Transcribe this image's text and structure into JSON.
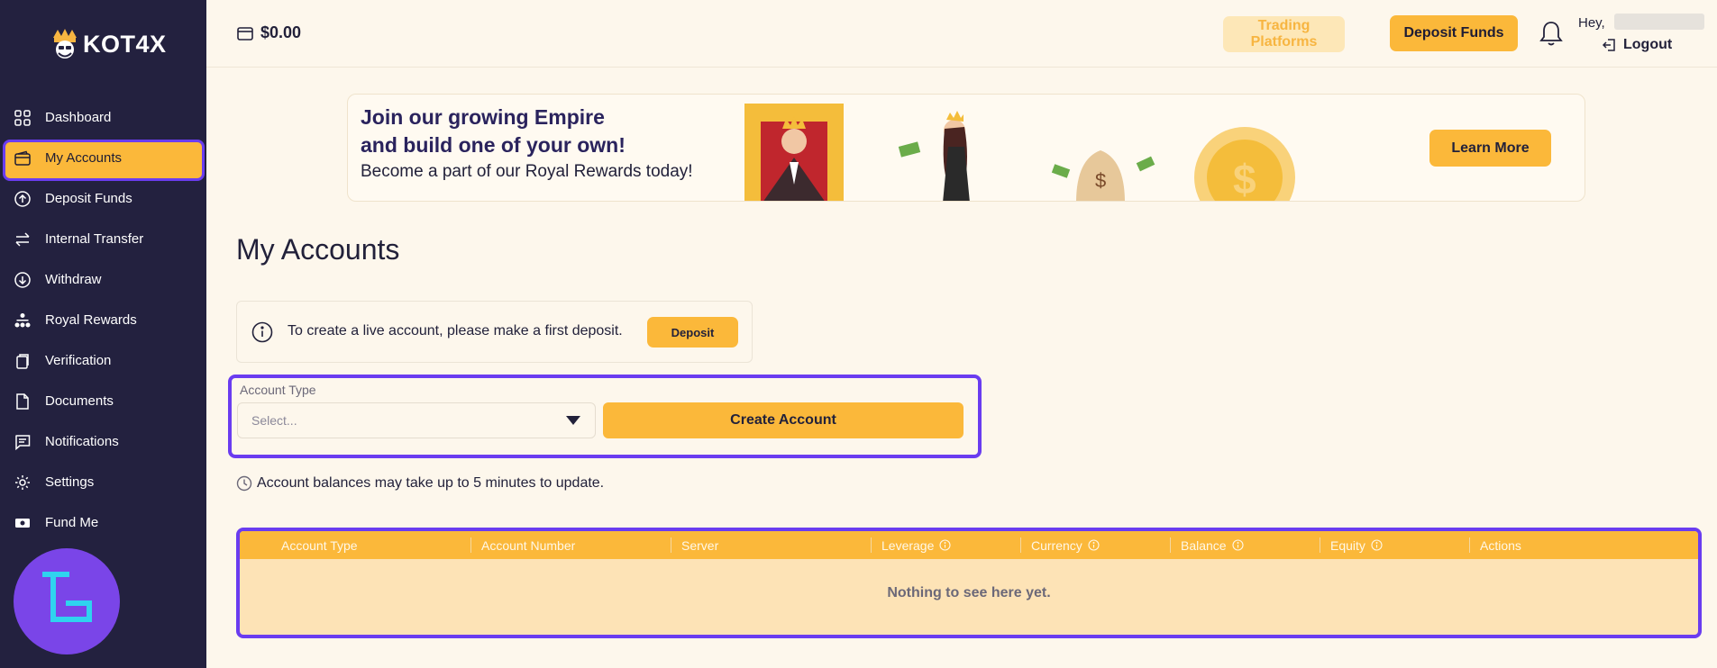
{
  "brand": {
    "name": "KOT4X"
  },
  "sidebar": {
    "items": [
      {
        "label": "Dashboard",
        "icon": "grid-icon"
      },
      {
        "label": "My Accounts",
        "icon": "wallet-icon",
        "active": true
      },
      {
        "label": "Deposit Funds",
        "icon": "arrow-up-circle-icon"
      },
      {
        "label": "Internal Transfer",
        "icon": "transfer-arrows-icon"
      },
      {
        "label": "Withdraw",
        "icon": "arrow-down-circle-icon"
      },
      {
        "label": "Royal Rewards",
        "icon": "hierarchy-icon"
      },
      {
        "label": "Verification",
        "icon": "document-copy-icon"
      },
      {
        "label": "Documents",
        "icon": "file-icon"
      },
      {
        "label": "Notifications",
        "icon": "message-icon"
      },
      {
        "label": "Settings",
        "icon": "gear-icon"
      },
      {
        "label": "Fund Me",
        "icon": "cash-icon"
      }
    ]
  },
  "header": {
    "balance": "$0.00",
    "trading_platforms": "Trading Platforms",
    "deposit_funds": "Deposit Funds",
    "greeting": "Hey,",
    "logout": "Logout"
  },
  "banner": {
    "headline_line1": "Join our growing Empire",
    "headline_line2": "and build one of your own!",
    "subtext": "Become a part of our Royal Rewards today!",
    "cta": "Learn More"
  },
  "main": {
    "title": "My Accounts",
    "info_text": "To create a live account, please make a first deposit.",
    "deposit_button": "Deposit",
    "account_type_label": "Account Type",
    "select_placeholder": "Select...",
    "create_button": "Create Account",
    "note": "Account balances may take up to 5 minutes to update."
  },
  "table": {
    "columns": [
      {
        "label": "Account Type",
        "info": false
      },
      {
        "label": "Account Number",
        "info": false
      },
      {
        "label": "Server",
        "info": false
      },
      {
        "label": "Leverage",
        "info": true
      },
      {
        "label": "Currency",
        "info": true
      },
      {
        "label": "Balance",
        "info": true
      },
      {
        "label": "Equity",
        "info": true
      },
      {
        "label": "Actions",
        "info": false
      }
    ],
    "empty_text": "Nothing to see here yet."
  },
  "colors": {
    "accent": "#fbb83a",
    "sidebar_bg": "#23213f",
    "highlight": "#6a3cf0",
    "page_bg": "#fdf7ec"
  }
}
